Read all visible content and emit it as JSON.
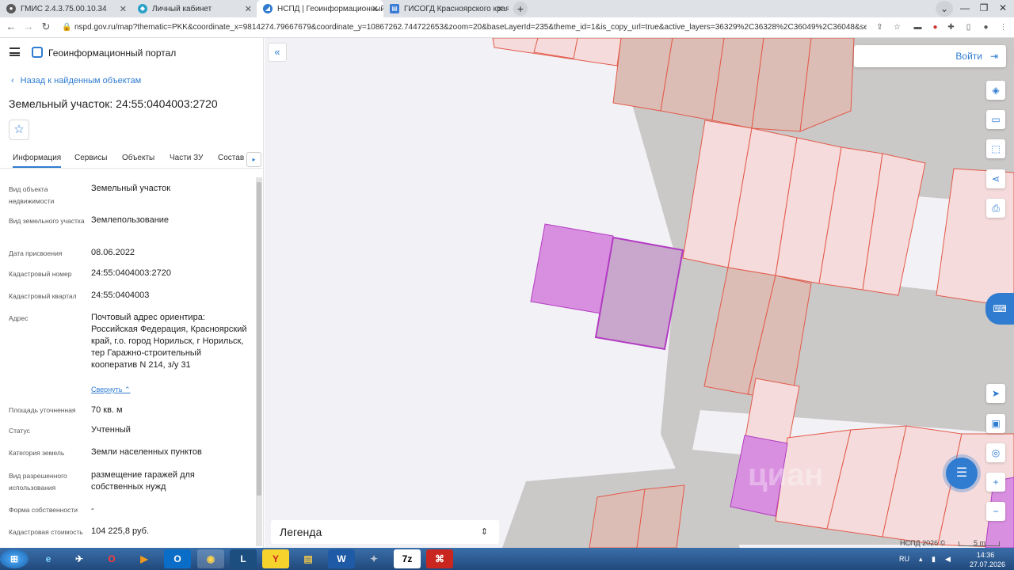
{
  "browser": {
    "tabs": [
      {
        "title": "ГМИС 2.4.3.75.00.10.34",
        "active": false,
        "color": "#5a5a5a"
      },
      {
        "title": "Личный кабинет",
        "active": false,
        "color": "#2aa1c9"
      },
      {
        "title": "НСПД | Геоинформационный п",
        "active": true,
        "color": "#2f7cd1"
      },
      {
        "title": "ГИСОГД Красноярского края",
        "active": false,
        "color": "#3a7bd5"
      }
    ],
    "new_tab": "+",
    "url": "nspd.gov.ru/map?thematic=PKK&coordinate_x=9814274.79667679&coordinate_y=10867262.744722653&zoom=20&baseLayerId=235&theme_id=1&is_copy_url=true&active_layers=36329%2C36328%2C36049%2C36048&selectedCard=1055..."
  },
  "header": {
    "app_title": "Геоинформационный портал",
    "back_link": "Назад к найденным объектам",
    "object_title": "Земельный участок: 24:55:0404003:2720"
  },
  "tabs": [
    "Информация",
    "Сервисы",
    "Объекты",
    "Части ЗУ",
    "Состав"
  ],
  "info": {
    "kind_label": "Вид объекта недвижимости",
    "kind_value": "Земельный участок",
    "land_kind_label": "Вид земельного участка",
    "land_kind_value": "Землепользование",
    "date_label": "Дата присвоения",
    "date_value": "08.06.2022",
    "cad_num_label": "Кадастровый номер",
    "cad_num_value": "24:55:0404003:2720",
    "cad_block_label": "Кадастровый квартал",
    "cad_block_value": "24:55:0404003",
    "address_label": "Адрес",
    "address_value": "Почтовый адрес ориентира: Российская Федерация, Красноярский край, г.о. город Норильск, г Норильск, тер Гаражно-строительный кооператив N 214, з/у 31",
    "collapse": "Свернуть",
    "area_label": "Площадь уточненная",
    "area_value": "70 кв. м",
    "status_label": "Статус",
    "status_value": "Учтенный",
    "category_label": "Категория земель",
    "category_value": "Земли населенных пунктов",
    "use_label": "Вид разрешенного использования",
    "use_value": "размещение гаражей для собственных нужд",
    "ownership_label": "Форма собственности",
    "ownership_value": "-",
    "cost_label": "Кадастровая стоимость",
    "cost_value": "104 225,8 руб."
  },
  "map": {
    "login": "Войти",
    "legend": "Легенда",
    "attribution": "НСПД 2026 ©",
    "scale": "5 m",
    "watermark": "циан"
  },
  "taskbar": {
    "lang": "RU",
    "time": "14:36",
    "date": "27.07.2026"
  },
  "colors": {
    "accent": "#2f7cd1",
    "parcel_selected": "#b23bc2",
    "parcel_border": "#e25a4a"
  }
}
